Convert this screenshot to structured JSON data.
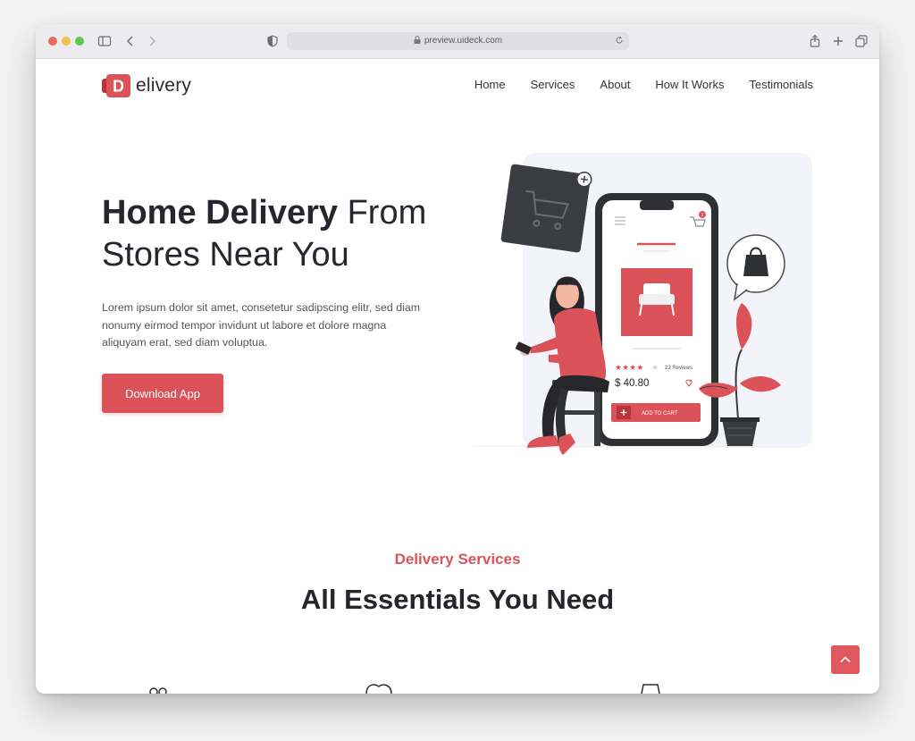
{
  "browser": {
    "url": "preview.uideck.com"
  },
  "brand": {
    "logo_letter": "D",
    "logo_word": "elivery",
    "accent_color": "#dc5259"
  },
  "nav": {
    "items": [
      {
        "label": "Home"
      },
      {
        "label": "Services"
      },
      {
        "label": "About"
      },
      {
        "label": "How It Works"
      },
      {
        "label": "Testimonials"
      }
    ]
  },
  "hero": {
    "title_bold": "Home Delivery",
    "title_light_1": "From",
    "title_light_2": "Stores Near You",
    "text": "Lorem ipsum dolor sit amet, consetetur sadipscing elitr, sed diam nonumy eirmod tempor invidunt ut labore et dolore magna aliquyam erat, sed diam voluptua.",
    "cta_label": "Download App"
  },
  "illustration": {
    "reviews_label": "23 Reviews",
    "price": "$ 40.80",
    "add_to_cart": "ADD TO CART",
    "cart_badge": "1"
  },
  "services": {
    "eyebrow": "Delivery Services",
    "title": "All Essentials You Need"
  },
  "icons": {
    "scroll_top": "chevron-up-icon",
    "sidebar": "sidebar-icon",
    "back": "chevron-left-icon",
    "forward": "chevron-right-icon",
    "shield": "shield-icon",
    "share": "share-icon",
    "new_tab": "plus-icon",
    "tabs": "tabs-icon"
  }
}
